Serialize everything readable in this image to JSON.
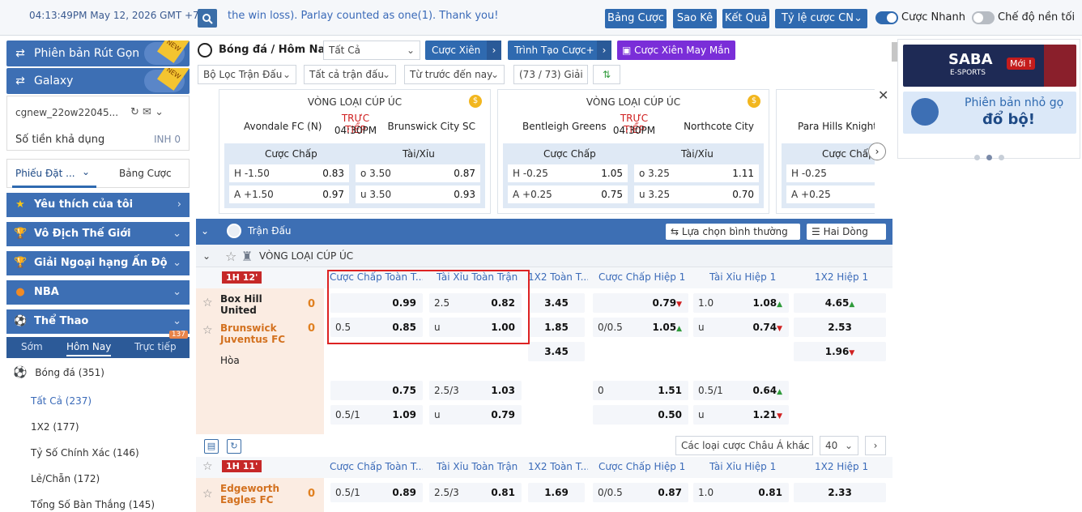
{
  "topbar": {
    "time": "04:13:49PM May 12, 2026 GMT +7",
    "marquee": "the win loss). Parlay counted as one(1). Thank you!",
    "buttons": [
      "Bảng Cược",
      "Sao Kê",
      "Kết Quả",
      "Tỷ lệ cược CN"
    ],
    "quick_bet": "Cược Nhanh",
    "dark_mode": "Chế độ nền tối"
  },
  "left": {
    "banner1": "Phiên bản Rút Gọn",
    "banner2": "Galaxy",
    "new_badge": "NEW",
    "username": "cgnew_22ow22045...",
    "balance_label": "Số tiền khả dụng",
    "balance_value": "INH 0",
    "tab_betslip": "Phiếu Đặt ...",
    "tab_mybets": "Bảng Cược",
    "sections": [
      "Yêu thích của tôi",
      "Vô Địch Thế Giới",
      "Giải Ngoại hạng Ấn Độ",
      "NBA",
      "Thể Thao"
    ],
    "sport_tabs": {
      "early": "Sớm",
      "today": "Hôm Nay",
      "live": "Trực tiếp",
      "live_count": "137"
    },
    "sport": {
      "name": "Bóng đá",
      "count": "(351)"
    },
    "markets": [
      {
        "name": "Tất Cả",
        "count": "(237)"
      },
      {
        "name": "1X2",
        "count": "(177)"
      },
      {
        "name": "Tỷ Số Chính Xác",
        "count": "(146)"
      },
      {
        "name": "Lẻ/Chẵn",
        "count": "(172)"
      },
      {
        "name": "Tổng Số Bàn Thắng",
        "count": "(145)"
      }
    ]
  },
  "center": {
    "breadcrumb": "Bóng đá / Hôm Nay",
    "filter_all": "Tất Cả",
    "btn_parlay": "Cược Xiên",
    "btn_builder": "Trình Tạo Cược+",
    "btn_lucky": "Cược Xiên May Mắn",
    "filter_league": "Bộ Lọc Trận Đấu",
    "filter_matches": "Tất cả trận đấu",
    "filter_time": "Từ trước đến nay",
    "league_count": "(73 / 73) Giải",
    "cards": [
      {
        "title": "VÒNG LOẠI CÚP ÚC",
        "home": "Avondale FC (N)",
        "away": "Brunswick City SC",
        "live": "TRỰC TIẾP",
        "time": "04:30PM",
        "hdp_label": "Cược Chấp",
        "ou_label": "Tài/Xỉu",
        "h": "H -1.50",
        "h_odds": "0.83",
        "a": "A +1.50",
        "a_odds": "0.97",
        "o": "o 3.50",
        "o_odds": "0.87",
        "u": "u 3.50",
        "u_odds": "0.93"
      },
      {
        "title": "VÒNG LOẠI CÚP ÚC",
        "home": "Bentleigh Greens",
        "away": "Northcote City",
        "live": "TRỰC TIẾP",
        "time": "04:30PM",
        "hdp_label": "Cược Chấp",
        "ou_label": "Tài/Xỉu",
        "h": "H -0.25",
        "h_odds": "1.05",
        "a": "A +0.25",
        "a_odds": "0.75",
        "o": "o 3.25",
        "o_odds": "1.11",
        "u": "u 3.25",
        "u_odds": "0.70"
      },
      {
        "title": "VÒNG LOẠI CÚP ÚC",
        "home": "Para Hills Knight",
        "hdp_label": "Cược Chấp",
        "h": "H -0.25",
        "a": "A +0.25"
      }
    ],
    "match_header": "Trận Đấu",
    "sel_normal": "Lựa chọn bình thường",
    "sel_lines": "Hai Dòng",
    "league_name": "VÒNG LOẠI CÚP ÚC",
    "columns": [
      "Cược Chấp Toàn T...",
      "Tài Xỉu Toàn Trận",
      "1X2 Toàn T...",
      "Cược Chấp Hiệp 1",
      "Tài Xỉu Hiệp 1",
      "1X2 Hiệp 1"
    ],
    "match1": {
      "tag": "1H 12'",
      "home": "Box Hill United",
      "away": "Brunswick Juventus FC",
      "draw": "Hòa",
      "home_score": "0",
      "away_score": "0",
      "r1": {
        "ft_hdp_line": "",
        "ft_hdp_odds": "0.99",
        "ft_ou_line": "2.5",
        "ft_ou_odds": "0.82",
        "ft_1x2": "3.45",
        "h1_hdp_line": "",
        "h1_hdp_odds": "0.79",
        "h1_ou_line": "1.0",
        "h1_ou_odds": "1.08",
        "h1_1x2": "4.65"
      },
      "r2": {
        "ft_hdp_line": "0.5",
        "ft_hdp_odds": "0.85",
        "ft_ou_line": "u",
        "ft_ou_odds": "1.00",
        "ft_1x2": "1.85",
        "h1_hdp_line": "0/0.5",
        "h1_hdp_odds": "1.05",
        "h1_ou_line": "u",
        "h1_ou_odds": "0.74",
        "h1_1x2": "2.53"
      },
      "r3": {
        "ft_1x2": "3.45",
        "h1_1x2": "1.96"
      },
      "r4": {
        "ft_hdp_odds": "0.75",
        "ft_ou_line": "2.5/3",
        "ft_ou_odds": "1.03",
        "h1_hdp_line": "0",
        "h1_hdp_odds": "1.51",
        "h1_ou_line": "0.5/1",
        "h1_ou_odds": "0.64"
      },
      "r5": {
        "ft_hdp_line": "0.5/1",
        "ft_hdp_odds": "1.09",
        "ft_ou_line": "u",
        "ft_ou_odds": "0.79",
        "h1_hdp_odds": "0.50",
        "h1_ou_line": "u",
        "h1_ou_odds": "1.21"
      }
    },
    "pager": {
      "odds_type": "Các loại cược Châu Á khác",
      "page_size": "40"
    },
    "match2": {
      "tag": "1H 11'",
      "home": "Edgeworth Eagles FC",
      "home_score": "0",
      "r1": {
        "ft_hdp_line": "0.5/1",
        "ft_hdp_odds": "0.89",
        "ft_ou_line": "2.5/3",
        "ft_ou_odds": "0.81",
        "ft_1x2": "1.69",
        "h1_hdp_line": "0/0.5",
        "h1_hdp_odds": "0.87",
        "h1_ou_line": "1.0",
        "h1_ou_odds": "0.81",
        "h1_1x2": "2.33"
      }
    }
  },
  "right": {
    "saba": "SABA",
    "esports": "E-SPORTS",
    "moi": "Mới !",
    "promo_line1": "Phiên bản nhỏ gọ",
    "promo_line2": "đổ bộ!"
  }
}
